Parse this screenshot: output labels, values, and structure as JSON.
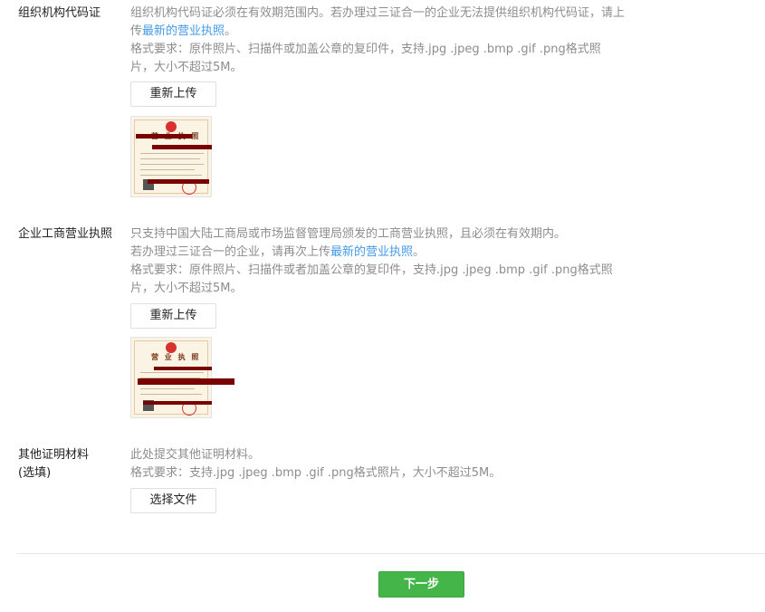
{
  "org_code_cert": {
    "label": "组织机构代码证",
    "desc1_pre": "组织机构代码证必须在有效期范围内。若办理过三证合一的企业无法提供组织机构代码证，请上",
    "desc1_pre2": "传",
    "desc1_link": "最新的营业执照",
    "desc1_post": "。",
    "format_line1": "格式要求：原件照片、扫描件或加盖公章的复印件，支持.jpg .jpeg .bmp .gif .png格式照",
    "format_line2": "片，大小不超过5M。",
    "button_label": "重新上传",
    "thumb_title": "营 业 执 照"
  },
  "business_license": {
    "label": "企业工商营业执照",
    "desc1": "只支持中国大陆工商局或市场监督管理局颁发的工商营业执照，且必须在有效期内。",
    "desc2_pre": "若办理过三证合一的企业，请再次上传",
    "desc2_link": "最新的营业执照",
    "desc2_post": "。",
    "format_line1": "格式要求：原件照片、扫描件或者加盖公章的复印件，支持.jpg .jpeg .bmp .gif .png格式照",
    "format_line2": "片，大小不超过5M。",
    "button_label": "重新上传",
    "thumb_title": "营 业 执 照"
  },
  "other_docs": {
    "label_line1": "其他证明材料",
    "label_line2": "(选填)",
    "desc1": "此处提交其他证明材料。",
    "format": "格式要求：支持.jpg .jpeg .bmp .gif .png格式照片，大小不超过5M。",
    "button_label": "选择文件"
  },
  "footer": {
    "next_label": "下一步"
  },
  "colors": {
    "link": "#459ae9",
    "primary_green": "#44b549",
    "redaction": "#7b0000"
  }
}
